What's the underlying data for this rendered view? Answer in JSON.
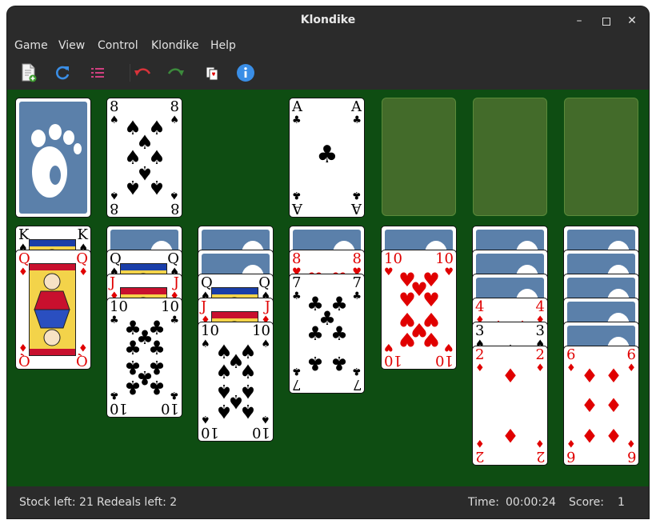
{
  "window": {
    "title": "Klondike"
  },
  "menu": {
    "game": "Game",
    "view": "View",
    "control": "Control",
    "klondike": "Klondike",
    "help": "Help"
  },
  "toolbar": {
    "buttons": [
      {
        "icon": "new-game-icon"
      },
      {
        "icon": "restart-icon"
      },
      {
        "icon": "select-game-icon"
      },
      {
        "icon": "undo-icon"
      },
      {
        "icon": "redo-icon"
      },
      {
        "icon": "hint-icon"
      },
      {
        "icon": "info-icon"
      }
    ]
  },
  "colors": {
    "felt": "#0e4d12",
    "card_back": "#5b80aa",
    "empty_slot": "#436b2a",
    "red_suit": "#e00000"
  },
  "stock": {
    "face": "down"
  },
  "waste": {
    "rank": "8",
    "suit": "♠"
  },
  "foundations": [
    {
      "rank": "A",
      "suit": "♣"
    },
    {
      "empty": true
    },
    {
      "empty": true
    },
    {
      "empty": true
    }
  ],
  "tableau": [
    {
      "hidden": 0,
      "up": [
        {
          "rank": "K",
          "suit": "♠"
        },
        {
          "rank": "Q",
          "suit": "♦"
        }
      ]
    },
    {
      "hidden": 1,
      "up": [
        {
          "rank": "Q",
          "suit": "♠"
        },
        {
          "rank": "J",
          "suit": "♦"
        },
        {
          "rank": "10",
          "suit": "♣"
        }
      ]
    },
    {
      "hidden": 2,
      "up": [
        {
          "rank": "Q",
          "suit": "♠"
        },
        {
          "rank": "J",
          "suit": "♦"
        },
        {
          "rank": "10",
          "suit": "♠"
        }
      ]
    },
    {
      "hidden": 1,
      "up": [
        {
          "rank": "8",
          "suit": "♥"
        },
        {
          "rank": "7",
          "suit": "♣"
        }
      ]
    },
    {
      "hidden": 1,
      "up": [
        {
          "rank": "10",
          "suit": "♥"
        }
      ]
    },
    {
      "hidden": 3,
      "up": [
        {
          "rank": "4",
          "suit": "♦"
        },
        {
          "rank": "3",
          "suit": "♠"
        },
        {
          "rank": "2",
          "suit": "♦"
        }
      ]
    },
    {
      "hidden": 5,
      "up": [
        {
          "rank": "6",
          "suit": "♦"
        }
      ]
    }
  ],
  "status": {
    "stock_left": "Stock left: 21",
    "redeals_left": "Redeals left: 2",
    "time_label": "Time:",
    "time_value": "00:00:24",
    "score_label": "Score:",
    "score_value": "1"
  }
}
